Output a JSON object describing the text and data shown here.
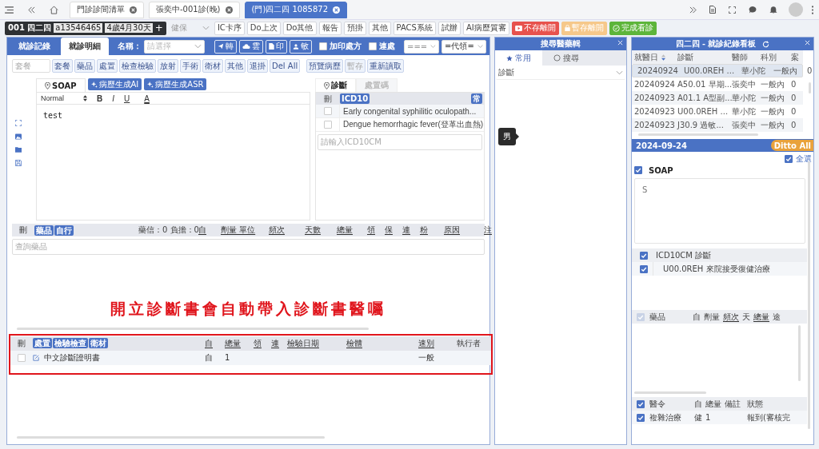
{
  "top_tabs": [
    {
      "label": "門診診間清單",
      "selected": false
    },
    {
      "label": "張奕中-001診(晚)",
      "selected": false
    },
    {
      "label": "(門)四二四 1085872",
      "selected": true
    }
  ],
  "patient": {
    "id": "001 四二四",
    "chart_no": "a13546465",
    "age": "4歲4月30天",
    "add": "+"
  },
  "insurance_select": {
    "value": "健保"
  },
  "toolbar_buttons": [
    {
      "label": "IC卡序",
      "kind": "plain"
    },
    {
      "label": "Do上次",
      "kind": "plain"
    },
    {
      "label": "Do其他",
      "kind": "plain"
    },
    {
      "label": "報告",
      "kind": "plain"
    },
    {
      "label": "預掛",
      "kind": "plain"
    },
    {
      "label": "其他",
      "kind": "plain"
    },
    {
      "label": "PACS系統",
      "kind": "plain"
    },
    {
      "label": "試辦",
      "kind": "plain"
    },
    {
      "label": "AI病歷質審",
      "kind": "plain"
    },
    {
      "label": "不存離開",
      "kind": "danger"
    },
    {
      "label": "暫存離開",
      "kind": "warning"
    },
    {
      "label": "完成看診",
      "kind": "success"
    }
  ],
  "left_panel": {
    "tabs": [
      {
        "label": "就診記錄",
        "selected": false
      },
      {
        "label": "就診明細",
        "selected": true
      }
    ],
    "name_label": "名稱：",
    "name_select": {
      "placeholder": "請選擇"
    },
    "icon_buttons": [
      "轉",
      "雲",
      "印",
      "敏"
    ],
    "checkboxes": [
      {
        "label": "加印處方",
        "checked": false
      },
      {
        "label": "連處",
        "checked": false
      }
    ],
    "selects": [
      "===",
      "=代領="
    ],
    "package_field": {
      "placeholder": "套餐"
    },
    "category_buttons": [
      {
        "label": "套餐",
        "disabled": false
      },
      {
        "label": "藥品",
        "disabled": false
      },
      {
        "label": "處置",
        "disabled": false
      },
      {
        "label": "檢查檢驗",
        "disabled": false
      },
      {
        "label": "放射",
        "disabled": false
      },
      {
        "label": "手術",
        "disabled": false
      },
      {
        "label": "衛材",
        "disabled": false
      },
      {
        "label": "其他",
        "disabled": false
      },
      {
        "label": "退掛",
        "disabled": false
      },
      {
        "label": "Del All",
        "disabled": false
      }
    ],
    "action_buttons": [
      {
        "label": "預覽病歷",
        "disabled": false
      },
      {
        "label": "暫存",
        "disabled": true
      },
      {
        "label": "重新讀取",
        "disabled": false
      }
    ],
    "soap": {
      "tab": "SOAP",
      "ai_buttons": [
        "病歷生成AI",
        "病歷生成ASR"
      ],
      "format_select": "Normal",
      "format_buttons": [
        {
          "label": "B",
          "kind": "bold"
        },
        {
          "label": "I",
          "kind": "italic"
        },
        {
          "label": "U",
          "kind": "underline"
        },
        {
          "label": "A",
          "kind": "color"
        }
      ],
      "text": "test"
    },
    "diagnosis": {
      "tabs": [
        {
          "label": "診斷",
          "selected": true
        },
        {
          "label": "處置碼",
          "selected": false
        }
      ],
      "header": {
        "delete": "刪",
        "code": "ICD10",
        "common": "常"
      },
      "rows": [
        {
          "checked": false,
          "text": "Early congenital syphilitic oculopath..."
        },
        {
          "checked": false,
          "text": "Dengue hemorrhagic fever(登革出血熱)"
        }
      ],
      "input": {
        "placeholder": "請輸入ICD10CM"
      }
    },
    "drugs": {
      "delete": "刪",
      "badges": [
        "藥品",
        "自行"
      ],
      "summary": "藥信：0 負擔：0",
      "columns": [
        "自",
        "劑量 單位",
        "頻次",
        "天數",
        "總量",
        "領",
        "保",
        "連",
        "粉",
        "原因",
        "注"
      ],
      "search": {
        "placeholder": "查詢藥品"
      }
    },
    "annotation": "開立診斷書會自動帶入診斷書醫囑",
    "orders": {
      "delete": "刪",
      "badges": [
        "處置",
        "檢驗檢查",
        "衛材"
      ],
      "columns": [
        {
          "label": "自",
          "sortable": true
        },
        {
          "label": "總量",
          "sortable": true
        },
        {
          "label": "領",
          "sortable": true
        },
        {
          "label": "連",
          "sortable": true
        },
        {
          "label": "檢驗日期",
          "sortable": true
        },
        {
          "label": "檢體",
          "sortable": true
        },
        {
          "label": "速別",
          "sortable": true
        },
        {
          "label": "執行者",
          "sortable": false
        }
      ],
      "rows": [
        {
          "checked": false,
          "name": "中文診斷證明書",
          "self": "自",
          "total": "1",
          "speed": "一般"
        }
      ]
    }
  },
  "middle_panel": {
    "title": "搜尋醫藥輯",
    "tabs": [
      {
        "label": "常用",
        "selected": true
      },
      {
        "label": "搜尋",
        "selected": false
      }
    ],
    "select": "診斷",
    "tooltip": "男"
  },
  "right_panel": {
    "title": "四二四 - 就診紀錄看板",
    "history": {
      "columns": [
        "就醫日",
        "診斷",
        "醫師",
        "科別",
        "案"
      ],
      "rows": [
        {
          "date": "20240924",
          "diagnosis": "U00.0REH ...",
          "doctor": "華小陀",
          "dept": "一般內",
          "case": "0",
          "selected": true
        },
        {
          "date": "20240924",
          "diagnosis": "A50.01 早期...",
          "doctor": "張奕中",
          "dept": "一般內",
          "case": "0",
          "selected": false
        },
        {
          "date": "20240923",
          "diagnosis": "A01.1 A型副...",
          "doctor": "華小陀",
          "dept": "一般內",
          "case": "0",
          "selected": false
        },
        {
          "date": "20240923",
          "diagnosis": "U00.0REH ...",
          "doctor": "華小陀",
          "dept": "一般內",
          "case": "0",
          "selected": false
        },
        {
          "date": "20240923",
          "diagnosis": "J30.9 過敏...",
          "doctor": "張奕中",
          "dept": "一般內",
          "case": "0",
          "selected": false
        }
      ]
    },
    "detail": {
      "date": "2024-09-24",
      "ditto": "Ditto All",
      "select_all": {
        "label": "全選",
        "checked": true
      },
      "soap": {
        "label": "SOAP",
        "checked": true,
        "text": "S"
      },
      "icd": {
        "label": "ICD10CM 診斷",
        "checked": true,
        "rows": [
          {
            "checked": true,
            "text": "U00.0REH 來院接受復健治療"
          }
        ]
      },
      "drugs": {
        "checked": true,
        "disabled": true,
        "columns": [
          "藥品",
          "自",
          "劑量",
          "頻次",
          "天",
          "總量",
          "途"
        ]
      },
      "orders": {
        "checked": true,
        "columns": [
          "醫令",
          "自",
          "總量",
          "備註",
          "狀態"
        ],
        "rows": [
          {
            "checked": true,
            "name": "複雜治療",
            "self": "健",
            "total": "1",
            "status": "報到(審核完"
          }
        ]
      }
    }
  }
}
